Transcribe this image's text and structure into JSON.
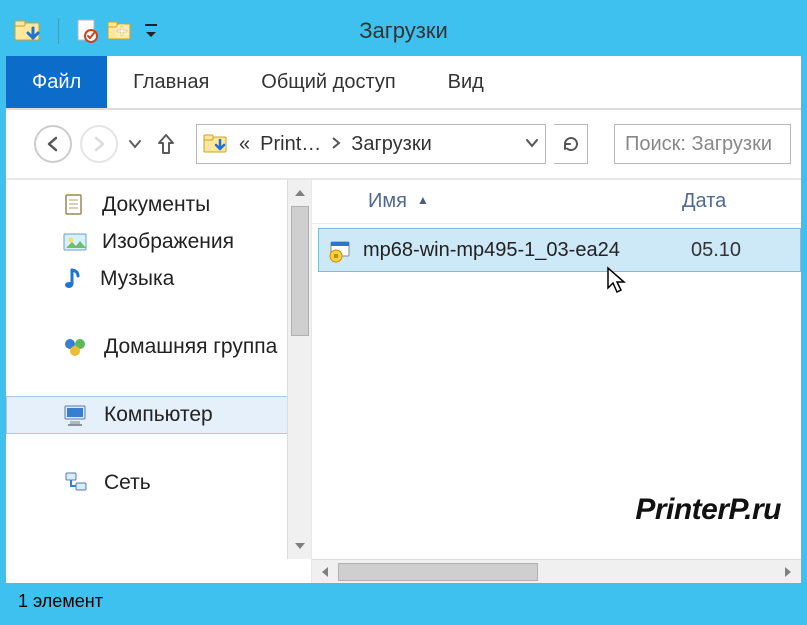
{
  "window": {
    "title": "Загрузки"
  },
  "ribbon": {
    "tabs": [
      {
        "label": "Файл",
        "active": true
      },
      {
        "label": "Главная",
        "active": false
      },
      {
        "label": "Общий доступ",
        "active": false
      },
      {
        "label": "Вид",
        "active": false
      }
    ]
  },
  "addressbar": {
    "crumb1": "Print…",
    "crumb2": "Загрузки"
  },
  "search": {
    "placeholder": "Поиск: Загрузки"
  },
  "sidebar": {
    "items": [
      {
        "label": "Документы",
        "icon": "documents-icon"
      },
      {
        "label": "Изображения",
        "icon": "pictures-icon"
      },
      {
        "label": "Музыка",
        "icon": "music-icon"
      }
    ],
    "group1": [
      {
        "label": "Домашняя группа",
        "icon": "homegroup-icon"
      }
    ],
    "group2": [
      {
        "label": "Компьютер",
        "icon": "computer-icon",
        "selected": true
      }
    ],
    "group3": [
      {
        "label": "Сеть",
        "icon": "network-icon"
      }
    ]
  },
  "columns": {
    "name": "Имя",
    "date": "Дата"
  },
  "files": [
    {
      "name": "mp68-win-mp495-1_03-ea24",
      "date": "05.10"
    }
  ],
  "statusbar": {
    "count": "1 элемент"
  },
  "watermark": "PrinterP.ru"
}
